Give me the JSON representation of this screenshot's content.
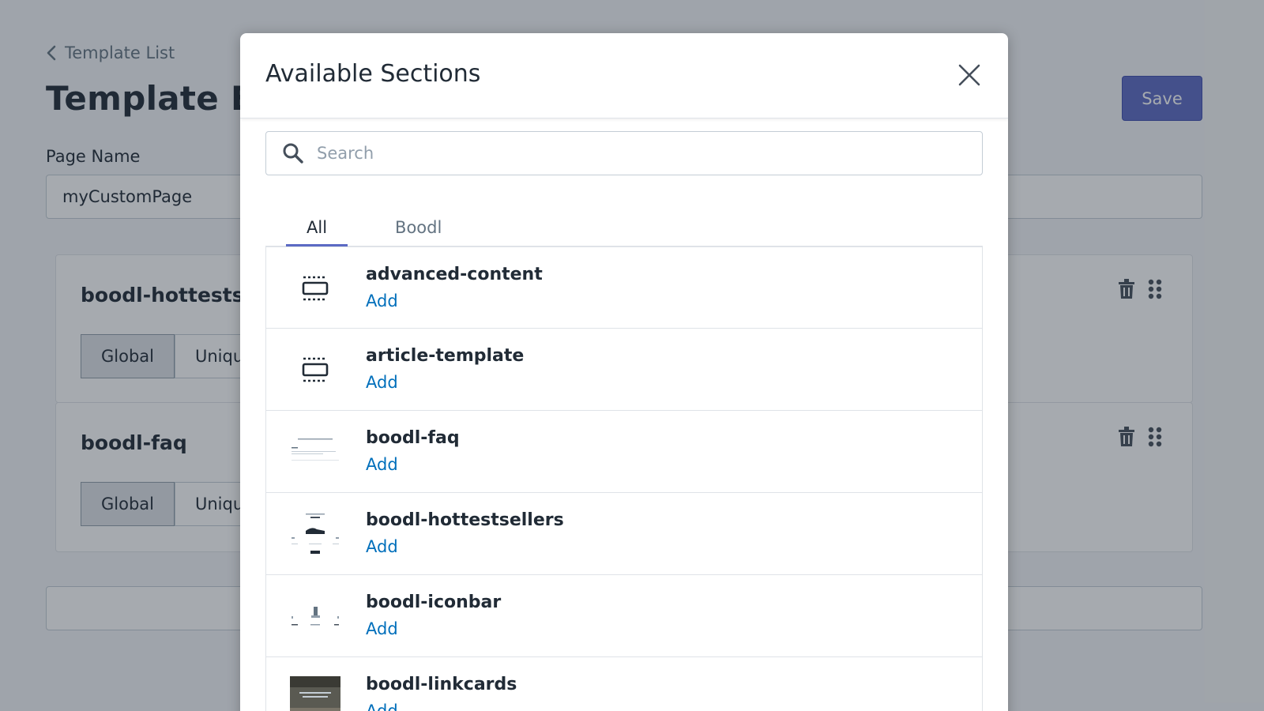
{
  "background": {
    "back_link": "Template List",
    "page_title": "Template Edi",
    "save_label": "Save",
    "page_name_label": "Page Name",
    "page_name_value": "myCustomPage",
    "sections": [
      {
        "name": "boodl-hottestsell",
        "global_label": "Global",
        "unique_label": "Uniqu"
      },
      {
        "name": "boodl-faq",
        "global_label": "Global",
        "unique_label": "Uniqu"
      }
    ]
  },
  "modal": {
    "title": "Available Sections",
    "search_placeholder": "Search",
    "tabs": [
      {
        "label": "All",
        "active": true
      },
      {
        "label": "Boodl",
        "active": false
      }
    ],
    "items": [
      {
        "name": "advanced-content",
        "add_label": "Add",
        "thumb": "section-icon"
      },
      {
        "name": "article-template",
        "add_label": "Add",
        "thumb": "section-icon"
      },
      {
        "name": "boodl-faq",
        "add_label": "Add",
        "thumb": "faq-preview"
      },
      {
        "name": "boodl-hottestsellers",
        "add_label": "Add",
        "thumb": "hottestsellers-preview"
      },
      {
        "name": "boodl-iconbar",
        "add_label": "Add",
        "thumb": "iconbar-preview"
      },
      {
        "name": "boodl-linkcards",
        "add_label": "Add",
        "thumb": "linkcards-preview"
      }
    ]
  },
  "colors": {
    "accent": "#5c6ac4",
    "link": "#006fbb",
    "overlay": "rgba(33,43,54,0.4)"
  }
}
